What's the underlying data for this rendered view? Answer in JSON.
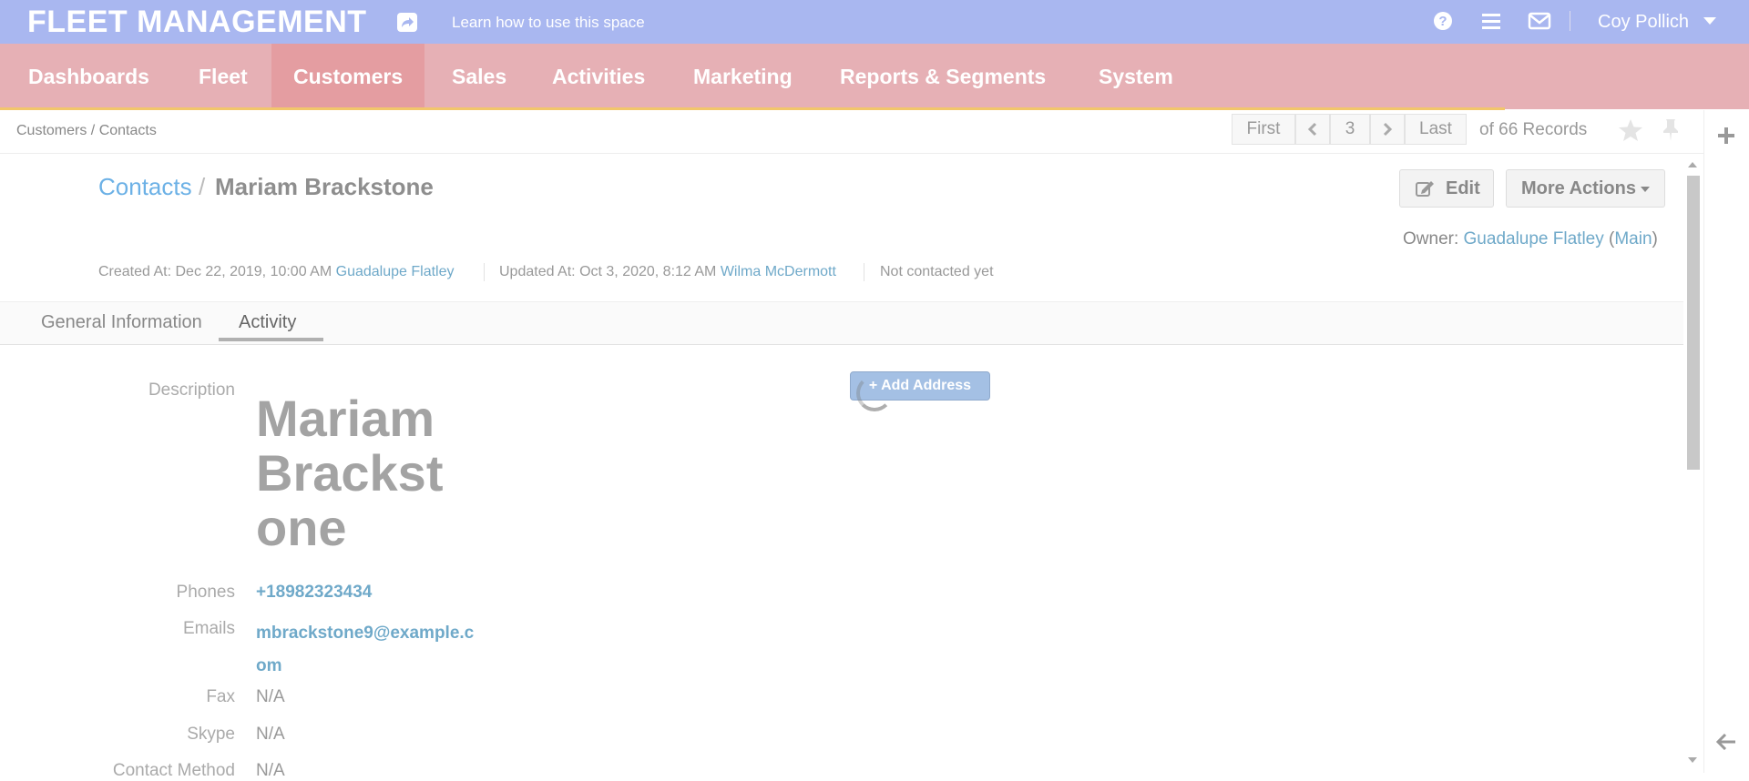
{
  "app": {
    "logo": "FLEET MANAGEMENT",
    "learn_link": "Learn how to use this space",
    "user_name": "Coy Pollich"
  },
  "nav": {
    "items": [
      "Dashboards",
      "Fleet",
      "Customers",
      "Sales",
      "Activities",
      "Marketing",
      "Reports & Segments",
      "System"
    ],
    "active": "Customers"
  },
  "breadcrumb": "Customers / Contacts",
  "pager": {
    "first": "First",
    "page": "3",
    "last": "Last",
    "records": "of 66 Records"
  },
  "record": {
    "entity_link": "Contacts",
    "separator": "/",
    "name": "Mariam Brackstone",
    "edit_label": "Edit",
    "more_actions_label": "More Actions",
    "owner_label": "Owner:",
    "owner_name": "Guadalupe Flatley",
    "owner_bu": "Main",
    "created_label": "Created At: Dec 22, 2019, 10:00 AM",
    "created_by": "Guadalupe Flatley",
    "updated_label": "Updated At: Oct 3, 2020, 8:12 AM",
    "updated_by": "Wilma McDermott",
    "contact_status": "Not contacted yet"
  },
  "tabs": [
    "General Information",
    "Activity"
  ],
  "active_tab": "Activity",
  "fields": {
    "description_label": "Description",
    "description_value": "Mariam Brackstone",
    "phones_label": "Phones",
    "phones_value": "+18982323434",
    "emails_label": "Emails",
    "emails_value": "mbrackstone9@example.com",
    "fax_label": "Fax",
    "fax_value": "N/A",
    "skype_label": "Skype",
    "skype_value": "N/A",
    "contact_method_label": "Contact Method",
    "contact_method_value": "N/A"
  },
  "add_address_label": "+ Add Address",
  "colors": {
    "topbar": "#a9b7f0",
    "navbar": "#e6b0b5",
    "nav_active": "#e49da1",
    "link": "#6cb1e6",
    "loader": "#f2c66b"
  }
}
